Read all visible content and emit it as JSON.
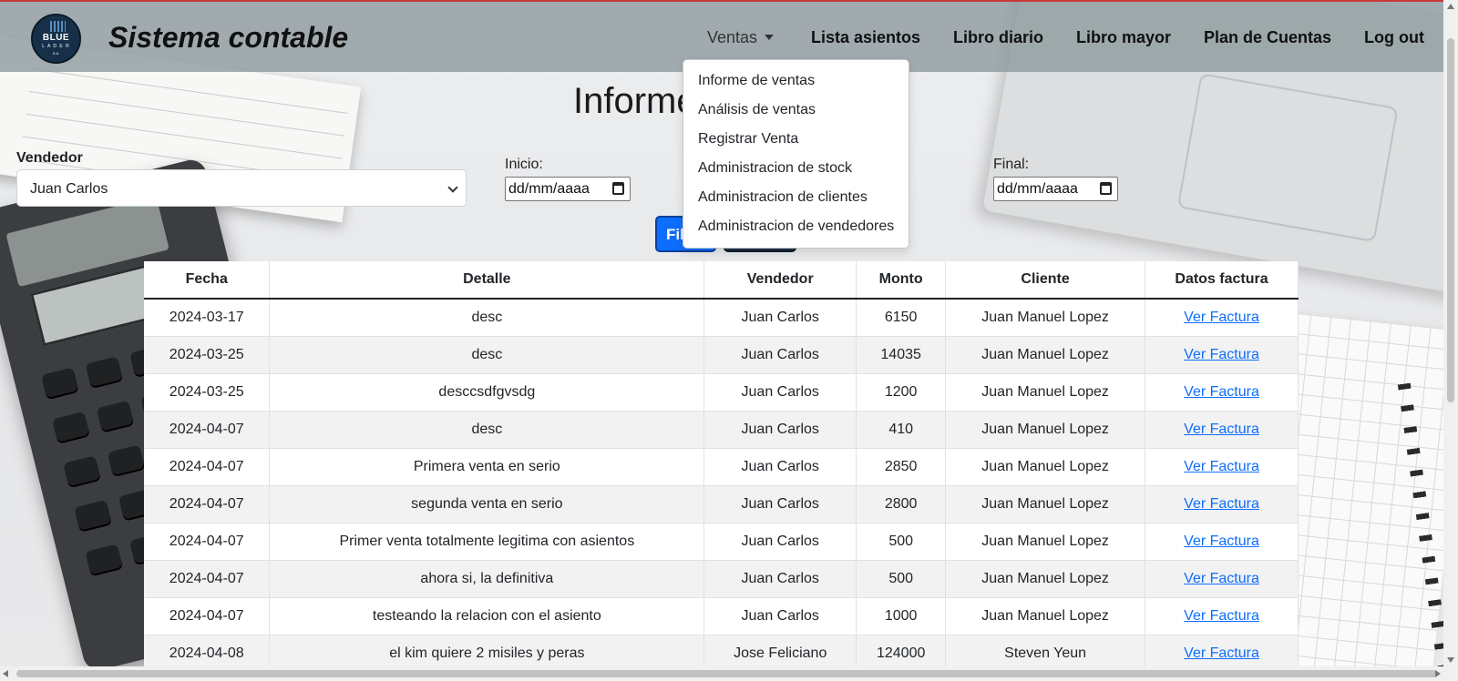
{
  "brand": {
    "logo_text": "BLUE",
    "logo_sub": "L A D E R",
    "logo_sub2": "S.A.",
    "title": "Sistema contable"
  },
  "nav": {
    "ventas": "Ventas",
    "lista_asientos": "Lista asientos",
    "libro_diario": "Libro diario",
    "libro_mayor": "Libro mayor",
    "plan_cuentas": "Plan de Cuentas",
    "logout": "Log out"
  },
  "dropdown": {
    "items": [
      "Informe de ventas",
      "Análisis de ventas",
      "Registrar Venta",
      "Administracion de stock",
      "Administracion de clientes",
      "Administracion de vendedores"
    ]
  },
  "page": {
    "title": "Informe"
  },
  "filters": {
    "vendedor_label": "Vendedor",
    "vendedor_value": "Juan Carlos",
    "inicio_label": "Inicio:",
    "inicio_placeholder": "dd/mm/aaaa",
    "final_label": "Final:",
    "final_placeholder": "dd/mm/aaaa",
    "filter_button": "Filtrar",
    "second_button": ""
  },
  "table": {
    "headers": [
      "Fecha",
      "Detalle",
      "Vendedor",
      "Monto",
      "Cliente",
      "Datos factura"
    ],
    "rows": [
      {
        "fecha": "2024-03-17",
        "detalle": "desc",
        "vendedor": "Juan Carlos",
        "monto": "6150",
        "cliente": "Juan Manuel Lopez",
        "factura": "Ver Factura"
      },
      {
        "fecha": "2024-03-25",
        "detalle": "desc",
        "vendedor": "Juan Carlos",
        "monto": "14035",
        "cliente": "Juan Manuel Lopez",
        "factura": "Ver Factura"
      },
      {
        "fecha": "2024-03-25",
        "detalle": "desccsdfgvsdg",
        "vendedor": "Juan Carlos",
        "monto": "1200",
        "cliente": "Juan Manuel Lopez",
        "factura": "Ver Factura"
      },
      {
        "fecha": "2024-04-07",
        "detalle": "desc",
        "vendedor": "Juan Carlos",
        "monto": "410",
        "cliente": "Juan Manuel Lopez",
        "factura": "Ver Factura"
      },
      {
        "fecha": "2024-04-07",
        "detalle": "Primera venta en serio",
        "vendedor": "Juan Carlos",
        "monto": "2850",
        "cliente": "Juan Manuel Lopez",
        "factura": "Ver Factura"
      },
      {
        "fecha": "2024-04-07",
        "detalle": "segunda venta en serio",
        "vendedor": "Juan Carlos",
        "monto": "2800",
        "cliente": "Juan Manuel Lopez",
        "factura": "Ver Factura"
      },
      {
        "fecha": "2024-04-07",
        "detalle": "Primer venta totalmente legitima con asientos",
        "vendedor": "Juan Carlos",
        "monto": "500",
        "cliente": "Juan Manuel Lopez",
        "factura": "Ver Factura"
      },
      {
        "fecha": "2024-04-07",
        "detalle": "ahora si, la definitiva",
        "vendedor": "Juan Carlos",
        "monto": "500",
        "cliente": "Juan Manuel Lopez",
        "factura": "Ver Factura"
      },
      {
        "fecha": "2024-04-07",
        "detalle": "testeando la relacion con el asiento",
        "vendedor": "Juan Carlos",
        "monto": "1000",
        "cliente": "Juan Manuel Lopez",
        "factura": "Ver Factura"
      },
      {
        "fecha": "2024-04-08",
        "detalle": "el kim quiere 2 misiles y peras",
        "vendedor": "Jose Feliciano",
        "monto": "124000",
        "cliente": "Steven Yeun",
        "factura": "Ver Factura"
      }
    ]
  },
  "colors": {
    "primary": "#0d6efd",
    "navbar": "#8c989c",
    "link": "#0d6efd"
  }
}
